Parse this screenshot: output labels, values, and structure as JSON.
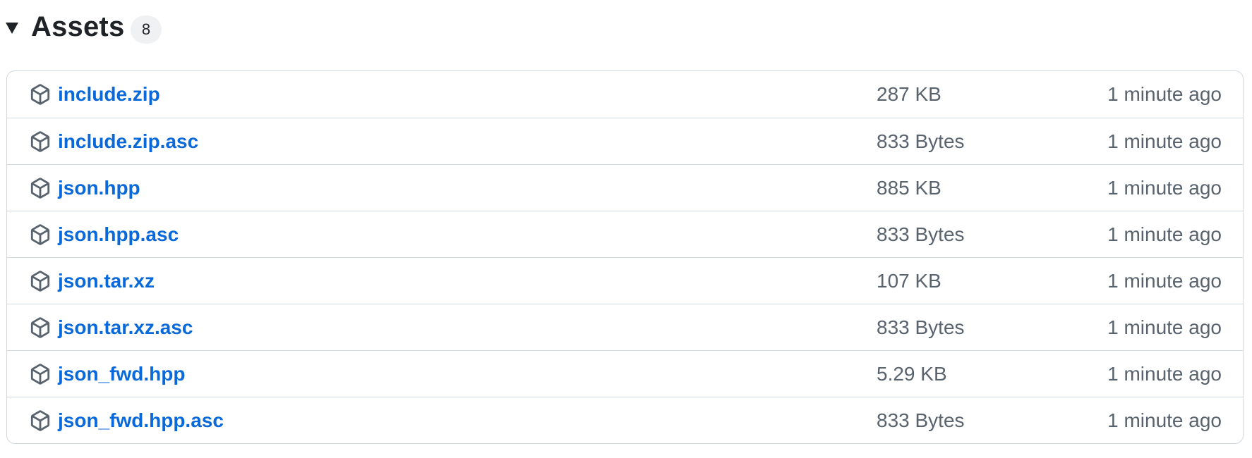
{
  "assets": {
    "title": "Assets",
    "count": "8",
    "toggle_icon": "triangle-down-icon",
    "item_icon": "package-icon",
    "colors": {
      "link": "#0969da",
      "muted": "#59636e",
      "border": "#d1d9e0",
      "badge_bg": "#eff1f3"
    },
    "items": [
      {
        "name": "include.zip",
        "size": "287 KB",
        "time": "1 minute ago"
      },
      {
        "name": "include.zip.asc",
        "size": "833 Bytes",
        "time": "1 minute ago"
      },
      {
        "name": "json.hpp",
        "size": "885 KB",
        "time": "1 minute ago"
      },
      {
        "name": "json.hpp.asc",
        "size": "833 Bytes",
        "time": "1 minute ago"
      },
      {
        "name": "json.tar.xz",
        "size": "107 KB",
        "time": "1 minute ago"
      },
      {
        "name": "json.tar.xz.asc",
        "size": "833 Bytes",
        "time": "1 minute ago"
      },
      {
        "name": "json_fwd.hpp",
        "size": "5.29 KB",
        "time": "1 minute ago"
      },
      {
        "name": "json_fwd.hpp.asc",
        "size": "833 Bytes",
        "time": "1 minute ago"
      }
    ]
  }
}
